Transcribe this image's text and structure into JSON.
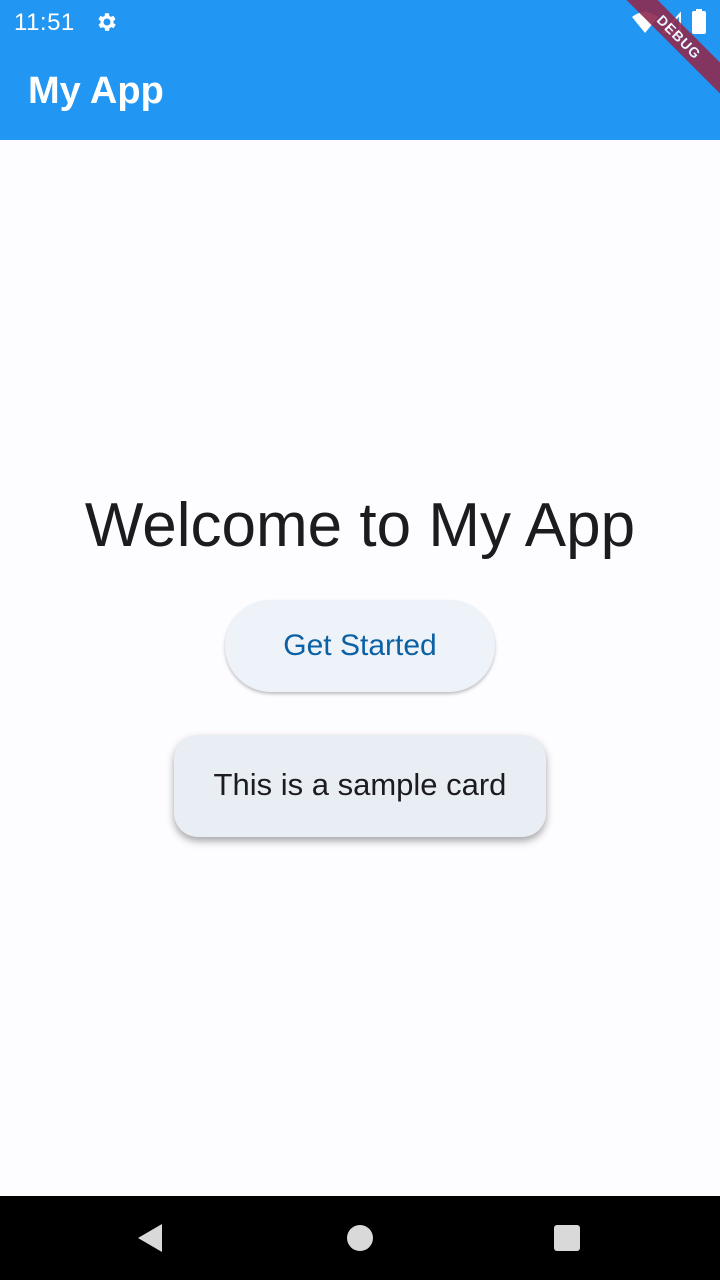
{
  "status_bar": {
    "time": "11:51",
    "left_icons": [
      "gear-icon"
    ],
    "right_icons": [
      "wifi-icon",
      "signal-icon",
      "battery-icon"
    ]
  },
  "app_bar": {
    "title": "My App",
    "color": "#2196f3"
  },
  "debug_banner": {
    "label": "DEBUG",
    "color": "#8e2a4f"
  },
  "main": {
    "welcome_text": "Welcome to My App",
    "button_label": "Get Started",
    "card_text": "This is a sample card",
    "accent_text_color": "#0c61a4"
  },
  "nav_bar": {
    "icons": [
      "back-triangle-icon",
      "home-circle-icon",
      "recents-square-icon"
    ]
  }
}
